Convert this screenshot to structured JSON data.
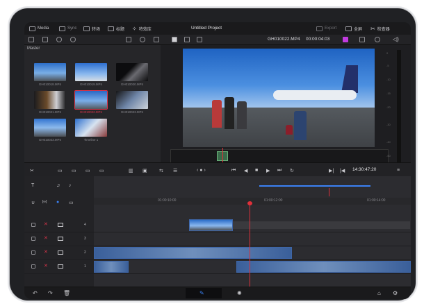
{
  "topbar": {
    "media": "Media",
    "sync": "Sync",
    "captions": "转场",
    "titles": "标题",
    "effects": "特效库",
    "project_title": "Untitled Project",
    "export": "Export",
    "fullscreen": "全屏",
    "inspector": "检查器"
  },
  "toolbar": {
    "clip_name": "GH010022.MP4",
    "timecode": "00:00:04:03"
  },
  "media_pool": {
    "bin": "Master",
    "clips": [
      {
        "label": "GH010018.MP4"
      },
      {
        "label": "GH010019.MP4"
      },
      {
        "label": "GH010020.MP4"
      },
      {
        "label": "GH010021.MP4"
      },
      {
        "label": "GH010022.MP4"
      },
      {
        "label": "GH010023.MP4"
      },
      {
        "label": "GH010023.MP4"
      },
      {
        "label": "Timeline 1"
      }
    ]
  },
  "transport": {
    "timecode": "14:30:47:20"
  },
  "ruler": {
    "marks": [
      "01:00:10:00",
      "01:00:12:00",
      "01:00:14:00"
    ]
  },
  "tracks": [
    {
      "number": "4"
    },
    {
      "number": "3"
    },
    {
      "number": "2"
    },
    {
      "number": "1"
    }
  ],
  "audio_meter": {
    "labels": [
      "0",
      "-5",
      "-10",
      "-15",
      "-20",
      "-30",
      "-40",
      "-50"
    ]
  },
  "colors": {
    "accent": "#d9344a",
    "playhead": "#e0303a",
    "clip": "#3e66a8"
  }
}
